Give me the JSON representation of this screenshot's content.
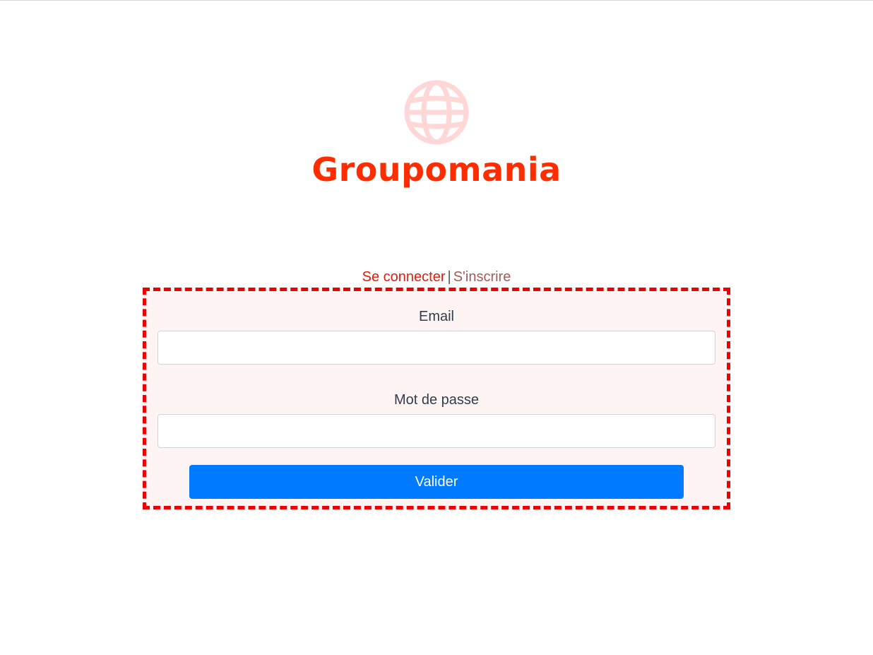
{
  "brand": {
    "name": "Groupomania",
    "logo_icon": "globe-icon",
    "color": "#fd2d01",
    "logo_color": "#ffd7d7"
  },
  "auth_switch": {
    "login_label": "Se connecter",
    "separator": "|",
    "signup_label": "S'inscrire"
  },
  "form": {
    "email_label": "Email",
    "email_value": "",
    "password_label": "Mot de passe",
    "password_value": "",
    "submit_label": "Valider",
    "submit_color": "#007bff",
    "border_color": "#ee0000"
  }
}
